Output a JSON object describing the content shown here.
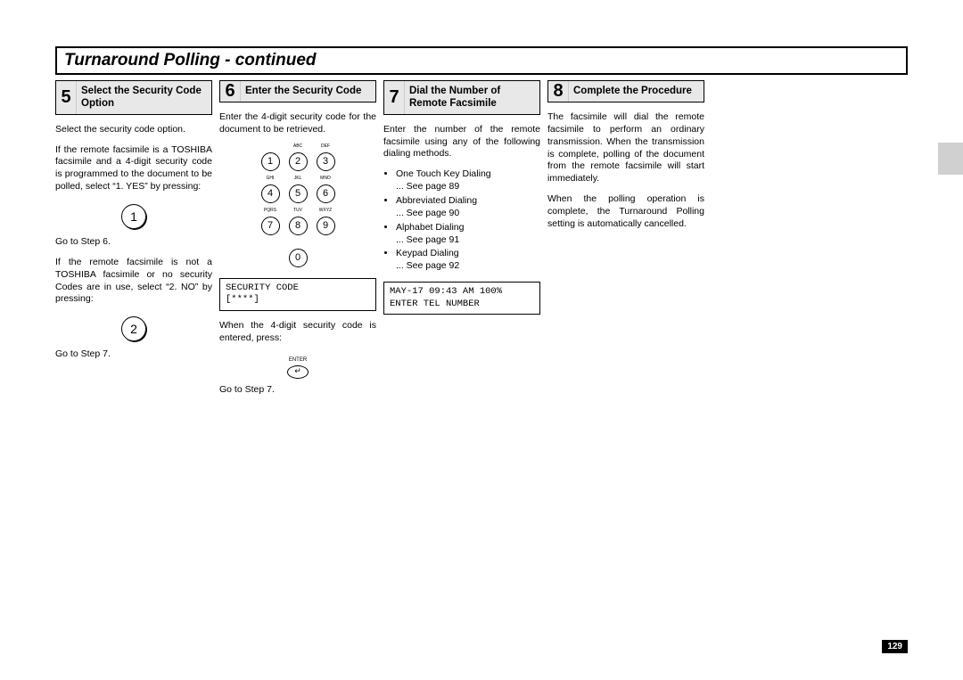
{
  "page_title": "Turnaround Polling - continued",
  "page_number": "129",
  "step5": {
    "num": "5",
    "title": "Select the Security Code Option",
    "p1": "Select the security code option.",
    "p2": "If the remote facsimile is a TOSHIBA facsimile and a 4-digit security code is programmed to the document to be polled, select “1. YES” by pressing:",
    "key1": "1",
    "goto1": "Go to Step 6.",
    "p3": "If the remote facsimile is not a TOSHIBA facsimile or no security Codes are in use, select “2. NO” by pressing:",
    "key2": "2",
    "goto2": "Go to Step 7."
  },
  "step6": {
    "num": "6",
    "title": "Enter the Security Code",
    "p1": "Enter the 4-digit security code for the document to be retrieved.",
    "keypad": {
      "r1": [
        {
          "d": "1",
          "l": ""
        },
        {
          "d": "2",
          "l": "ABC"
        },
        {
          "d": "3",
          "l": "DEF"
        }
      ],
      "r2": [
        {
          "d": "4",
          "l": "GHI"
        },
        {
          "d": "5",
          "l": "JKL"
        },
        {
          "d": "6",
          "l": "MNO"
        }
      ],
      "r3": [
        {
          "d": "7",
          "l": "PQRS"
        },
        {
          "d": "8",
          "l": "TUV"
        },
        {
          "d": "9",
          "l": "WXYZ"
        }
      ],
      "r4": [
        {
          "d": "0",
          "l": ""
        }
      ]
    },
    "lcd": "SECURITY CODE\n[****]",
    "p2": "When the 4-digit security code is entered, press:",
    "enter_label": "ENTER",
    "enter_glyph": "↵",
    "goto": "Go to Step 7."
  },
  "step7": {
    "num": "7",
    "title": "Dial the Number of Remote Facsimile",
    "p1": "Enter the number of the remote facsimile using any of the following dialing methods.",
    "items": [
      {
        "name": "One Touch Key Dialing",
        "ref": "... See page 89"
      },
      {
        "name": "Abbreviated Dialing",
        "ref": "... See page 90"
      },
      {
        "name": "Alphabet Dialing",
        "ref": "... See page 91"
      },
      {
        "name": "Keypad Dialing",
        "ref": "... See page 92"
      }
    ],
    "lcd": "MAY-17 09:43 AM 100%\nENTER TEL NUMBER"
  },
  "step8": {
    "num": "8",
    "title": "Complete the Procedure",
    "p1": "The facsimile will dial the remote facsimile to perform an ordinary transmission. When the transmission is complete, polling of the document from the remote facsimile will start immediately.",
    "p2": "When the polling operation is complete, the Turnaround Polling setting is automatically cancelled."
  }
}
